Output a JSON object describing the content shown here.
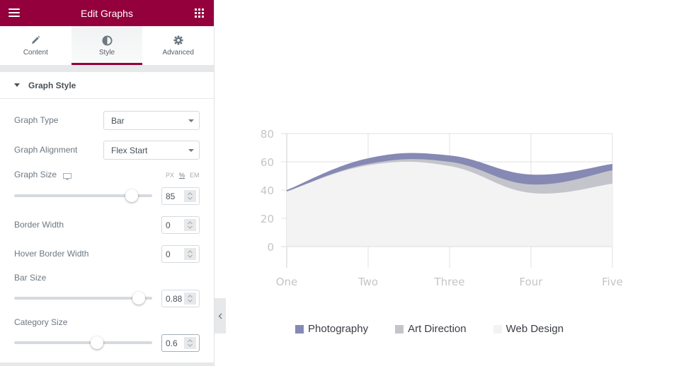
{
  "header": {
    "title": "Edit Graphs",
    "menu_icon": "hamburger-icon",
    "apps_icon": "grid-icon",
    "brand_color": "#93003c"
  },
  "tabs": [
    {
      "label": "Content",
      "icon": "pencil-icon",
      "active": false
    },
    {
      "label": "Style",
      "icon": "contrast-icon",
      "active": true
    },
    {
      "label": "Advanced",
      "icon": "gear-icon",
      "active": false
    }
  ],
  "section": {
    "title": "Graph Style",
    "controls": {
      "graph_type": {
        "label": "Graph Type",
        "value": "Bar"
      },
      "graph_alignment": {
        "label": "Graph Alignment",
        "value": "Flex Start"
      },
      "graph_size": {
        "label": "Graph Size",
        "value": "85",
        "units": [
          "PX",
          "%",
          "EM"
        ],
        "selected_unit": "%",
        "slider_fraction": 0.85
      },
      "border_width": {
        "label": "Border Width",
        "value": "0"
      },
      "hover_border_width": {
        "label": "Hover Border Width",
        "value": "0"
      },
      "bar_size": {
        "label": "Bar Size",
        "value": "0.88",
        "slider_fraction": 0.9
      },
      "category_size": {
        "label": "Category Size",
        "value": "0.6",
        "slider_fraction": 0.6
      }
    }
  },
  "chart_data": {
    "type": "area",
    "stacked": true,
    "smooth": true,
    "categories": [
      "One",
      "Two",
      "Three",
      "Four",
      "Five"
    ],
    "series": [
      {
        "name": "Web Design",
        "values": [
          39,
          57.5,
          57,
          38,
          44.5
        ],
        "color": "#f3f3f3"
      },
      {
        "name": "Art Direction",
        "values": [
          0,
          1,
          3,
          6,
          9.5
        ],
        "color": "#c4c5ca"
      },
      {
        "name": "Photography",
        "values": [
          1,
          4,
          4.5,
          7,
          4.5
        ],
        "color": "#8589b3"
      }
    ],
    "ylim": [
      0,
      80
    ],
    "yticks": [
      "0",
      "20",
      "40",
      "60",
      "80"
    ],
    "grid": true,
    "legend_position": "bottom",
    "title": "",
    "xlabel": "",
    "ylabel": ""
  }
}
